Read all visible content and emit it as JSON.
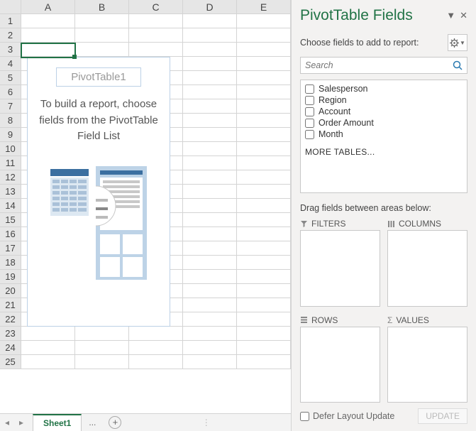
{
  "columns": [
    "A",
    "B",
    "C",
    "D",
    "E"
  ],
  "rows": [
    "1",
    "2",
    "3",
    "4",
    "5",
    "6",
    "7",
    "8",
    "9",
    "10",
    "11",
    "12",
    "13",
    "14",
    "15",
    "16",
    "17",
    "18",
    "19",
    "20",
    "21",
    "22",
    "23",
    "24",
    "25"
  ],
  "pivot": {
    "title": "PivotTable1",
    "msg1": "To build a report, choose",
    "msg2": "fields from the PivotTable",
    "msg3": "Field List"
  },
  "tabs": {
    "sheet": "Sheet1",
    "more": "..."
  },
  "pane": {
    "title": "PivotTable Fields",
    "subtitle": "Choose fields to add to report:",
    "searchPlaceholder": "Search",
    "fields": [
      "Salesperson",
      "Region",
      "Account",
      "Order Amount",
      "Month"
    ],
    "moreTables": "MORE TABLES...",
    "areasLabel": "Drag fields between areas below:",
    "areas": {
      "filters": "FILTERS",
      "columns": "COLUMNS",
      "rows": "ROWS",
      "values": "VALUES"
    },
    "defer": "Defer Layout Update",
    "update": "UPDATE"
  }
}
